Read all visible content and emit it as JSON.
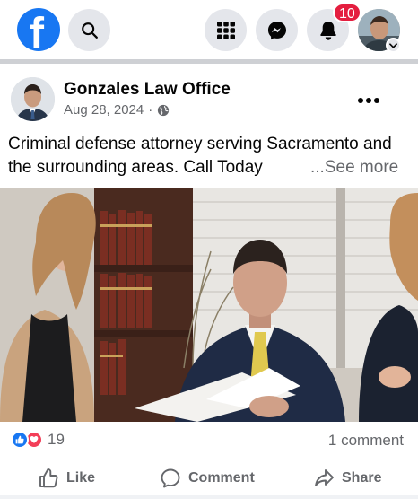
{
  "topbar": {
    "logo_letter": "f",
    "notification_count": "10",
    "icons": {
      "search": "search-icon",
      "menu": "grid-menu-icon",
      "messenger": "messenger-icon",
      "notifications": "bell-icon",
      "profile": "profile-avatar",
      "chevron": "chevron-down-icon"
    }
  },
  "post": {
    "page_name": "Gonzales Law Office",
    "date": "Aug 28, 2024",
    "separator": "·",
    "audience_icon": "globe-icon",
    "text": "Criminal defense attorney serving Sacramento and the surrounding areas. Call Today",
    "see_more": "...See more",
    "reaction_count": "19",
    "comment_count": "1 comment"
  },
  "actions": {
    "like": "Like",
    "comment": "Comment",
    "share": "Share"
  },
  "colors": {
    "brand": "#1877F2",
    "badge": "#E41E3F",
    "love": "#F33E58",
    "secondary_text": "#65676B",
    "button_bg": "#E4E6EB"
  }
}
